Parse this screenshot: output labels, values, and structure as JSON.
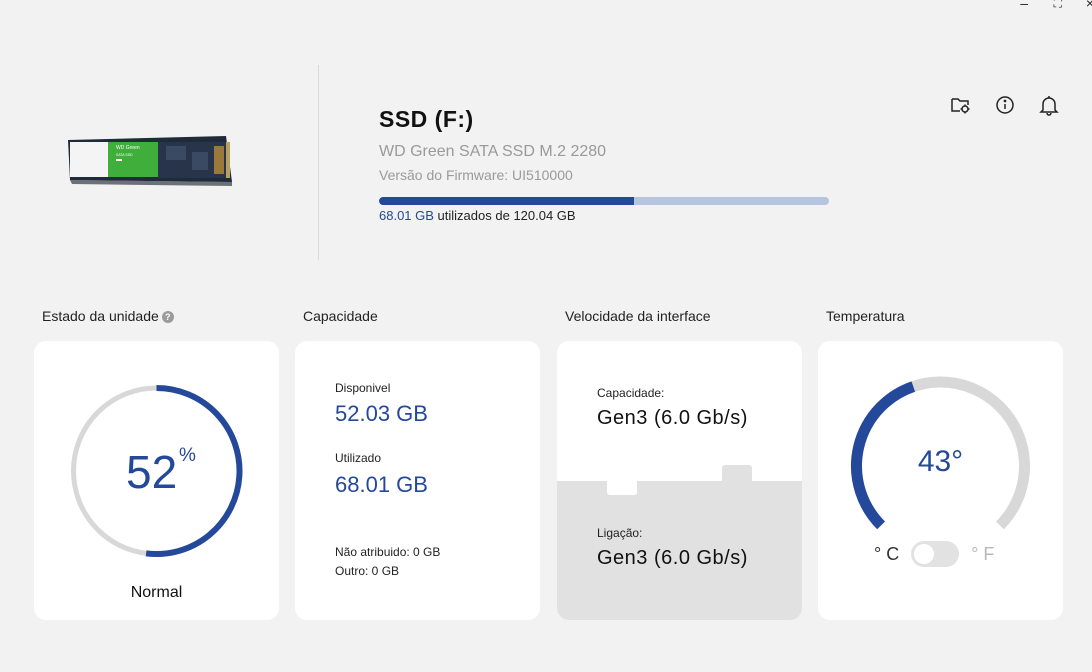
{
  "window": {
    "minimize_glyph": "–",
    "maximize_glyph": "⛶",
    "close_glyph": "×"
  },
  "drive": {
    "title": "SSD (F:)",
    "model": "WD Green SATA SSD M.2 2280",
    "firmware": "Versão do Firmware: UI510000",
    "image_brand": "WD Green",
    "image_subtitle": "SATA SSD",
    "usage": {
      "used": "68.01 GB",
      "separator": " utilizados de ",
      "total": "120.04 GB",
      "fraction": 0.5666
    }
  },
  "top_icons": [
    "folder-settings-icon",
    "info-icon",
    "bell-icon"
  ],
  "sections": {
    "health": "Estado da unidade",
    "capacity": "Capacidade",
    "speed": "Velocidade da interface",
    "temperature": "Temperatura"
  },
  "health": {
    "percent": "52",
    "percent_sign": "%",
    "state": "Normal",
    "fraction": 0.52
  },
  "capacity": {
    "available_label": "Disponivel",
    "available_value": "52.03 GB",
    "used_label": "Utilizado",
    "used_value": "68.01 GB",
    "unallocated": "Não atribuido: 0 GB",
    "other": "Outro: 0 GB"
  },
  "speed": {
    "capacity_label": "Capacidade:",
    "capacity_value": "Gen3 (6.0 Gb/s)",
    "link_label": "Ligação:",
    "link_value": "Gen3 (6.0 Gb/s)"
  },
  "temperature": {
    "value": "43°",
    "unit_c": "° C",
    "unit_f": "° F",
    "selected_unit": "C",
    "fraction": 0.43
  },
  "colors": {
    "accent": "#24489a",
    "track": "#d8d8d8",
    "background": "#f2f2f2"
  }
}
